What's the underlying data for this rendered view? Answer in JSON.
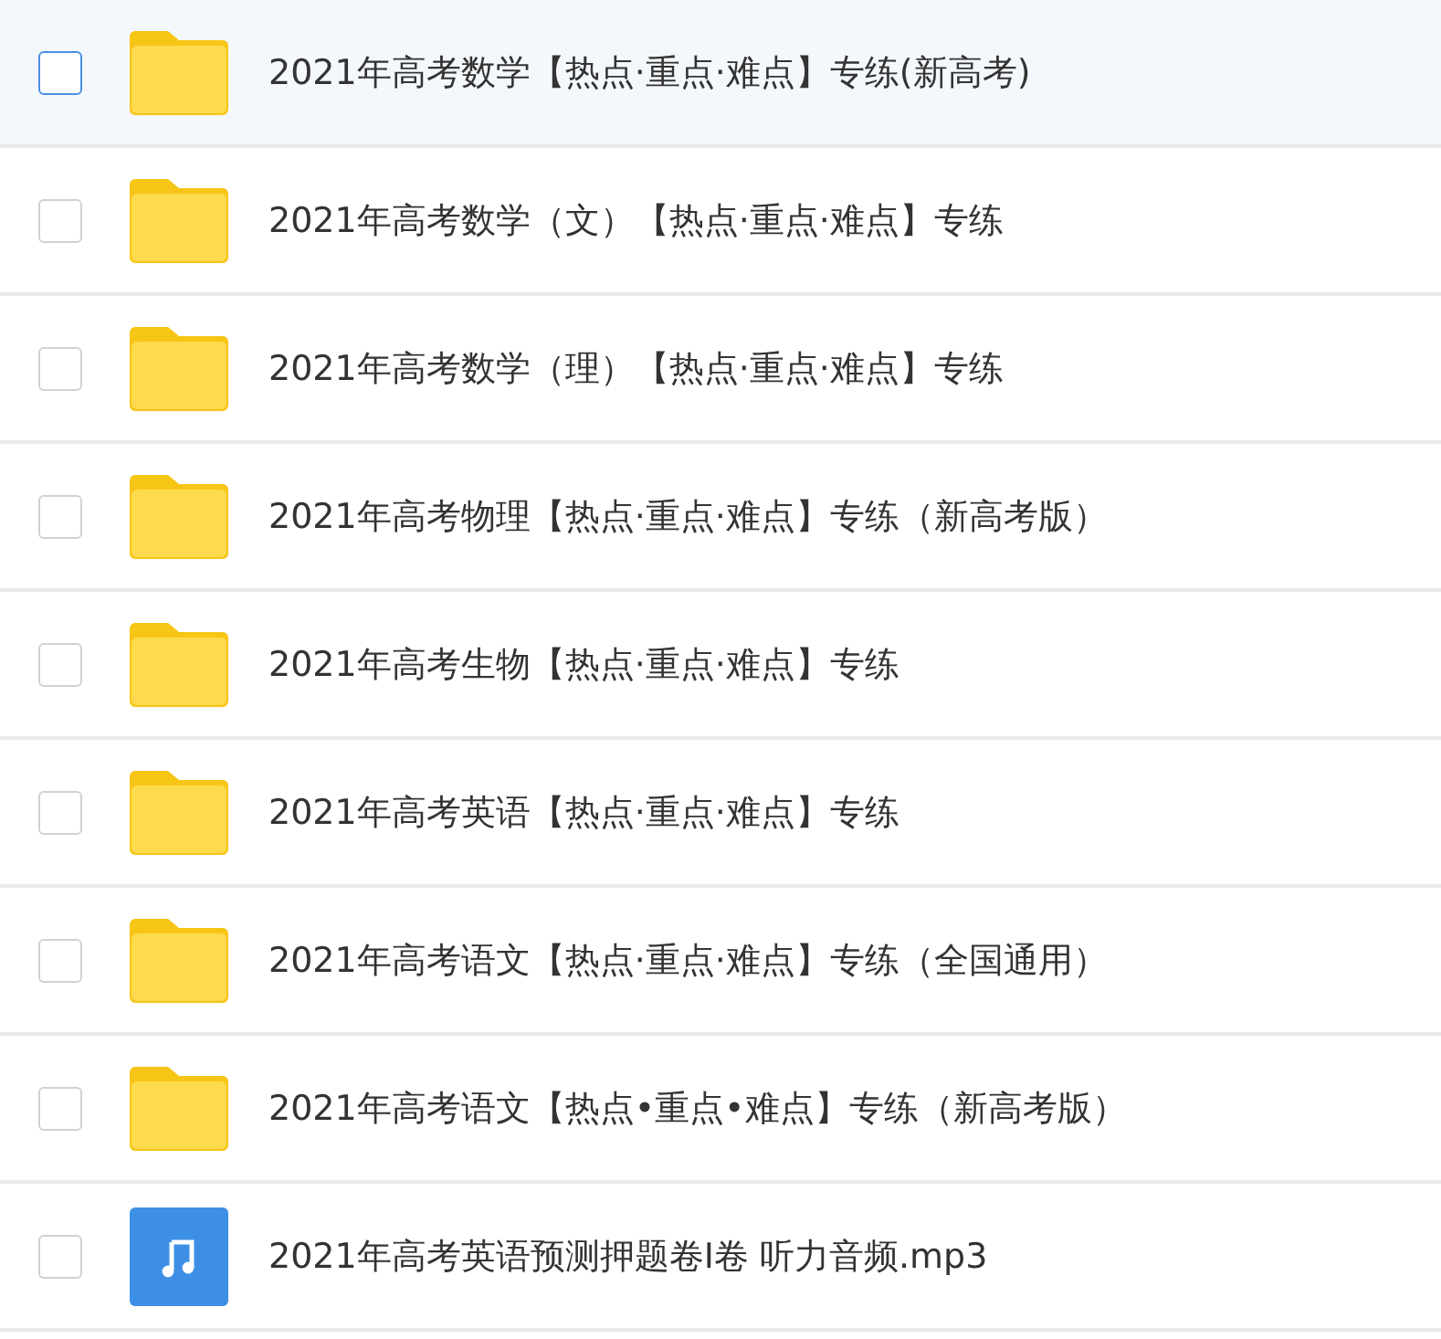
{
  "files": [
    {
      "kind": "folder",
      "name": "2021年高考数学【热点·重点·难点】专练(新高考)",
      "highlighted": true,
      "checked": false
    },
    {
      "kind": "folder",
      "name": "2021年高考数学（文）【热点·重点·难点】专练",
      "highlighted": false,
      "checked": false
    },
    {
      "kind": "folder",
      "name": "2021年高考数学（理）【热点·重点·难点】专练",
      "highlighted": false,
      "checked": false
    },
    {
      "kind": "folder",
      "name": "2021年高考物理【热点·重点·难点】专练（新高考版）",
      "highlighted": false,
      "checked": false
    },
    {
      "kind": "folder",
      "name": "2021年高考生物【热点·重点·难点】专练",
      "highlighted": false,
      "checked": false
    },
    {
      "kind": "folder",
      "name": "2021年高考英语【热点·重点·难点】专练",
      "highlighted": false,
      "checked": false
    },
    {
      "kind": "folder",
      "name": "2021年高考语文【热点·重点·难点】专练（全国通用）",
      "highlighted": false,
      "checked": false
    },
    {
      "kind": "folder",
      "name": "2021年高考语文【热点•重点•难点】专练（新高考版）",
      "highlighted": false,
      "checked": false
    },
    {
      "kind": "audio",
      "name": "2021年高考英语预测押题卷Ⅰ卷 听力音频.mp3",
      "highlighted": false,
      "checked": false
    }
  ]
}
